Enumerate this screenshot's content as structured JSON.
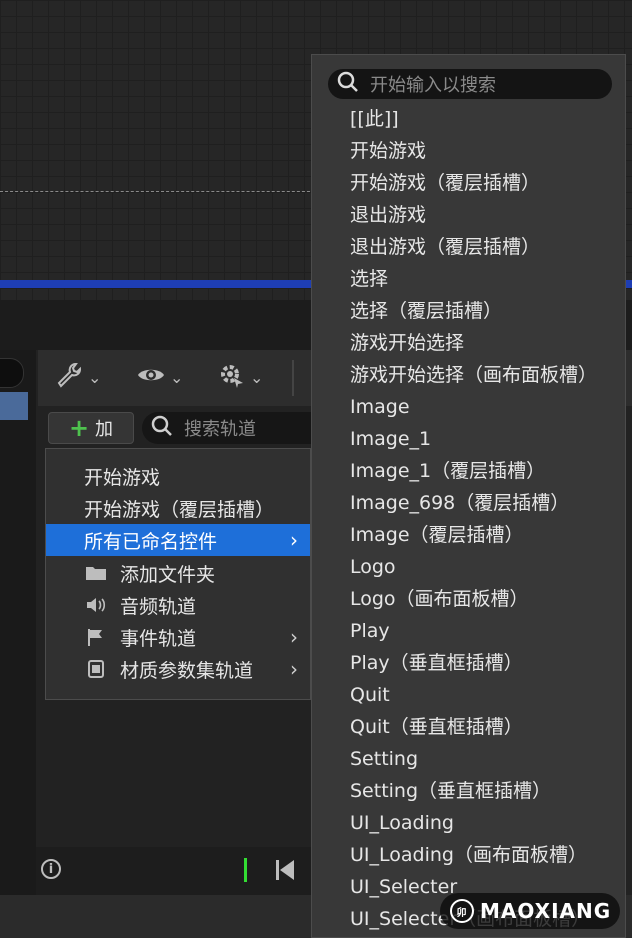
{
  "toolbar": {
    "add_label": "加",
    "search_placeholder": "搜索轨道",
    "icons": [
      "wrench-icon",
      "eye-icon",
      "gear-icon"
    ]
  },
  "context_menu": {
    "items": [
      {
        "label": "开始游戏",
        "icon": "",
        "submenu": false,
        "selected": false
      },
      {
        "label": "开始游戏（覆层插槽）",
        "icon": "",
        "submenu": false,
        "selected": false
      },
      {
        "label": "所有已命名控件",
        "icon": "",
        "submenu": true,
        "selected": true
      },
      {
        "label": "添加文件夹",
        "icon": "folder-icon",
        "submenu": false,
        "selected": false
      },
      {
        "label": "音频轨道",
        "icon": "speaker-icon",
        "submenu": false,
        "selected": false
      },
      {
        "label": "事件轨道",
        "icon": "flag-icon",
        "submenu": true,
        "selected": false
      },
      {
        "label": "材质参数集轨道",
        "icon": "material-icon",
        "submenu": true,
        "selected": false
      }
    ]
  },
  "dropdown": {
    "search_placeholder": "开始输入以搜索",
    "items": [
      "[[此]]",
      "开始游戏",
      "开始游戏（覆层插槽）",
      "退出游戏",
      "退出游戏（覆层插槽）",
      "选择",
      "选择（覆层插槽）",
      "游戏开始选择",
      "游戏开始选择（画布面板槽）",
      "Image",
      "Image_1",
      "Image_1（覆层插槽）",
      "Image_698（覆层插槽）",
      "Image（覆层插槽）",
      "Logo",
      "Logo（画布面板槽）",
      "Play",
      "Play（垂直框插槽）",
      "Quit",
      "Quit（垂直框插槽）",
      "Setting",
      "Setting（垂直框插槽）",
      "UI_Loading",
      "UI_Loading（画布面板槽）",
      "UI_Selecter",
      "UI_Selecter（画布面板槽）"
    ]
  },
  "watermark": {
    "text": "MAOXIANG",
    "logo_text": "卯"
  },
  "colors": {
    "selected": "#1e6fd9",
    "accent_green": "#4ec24e",
    "timeline_blue": "#1e3eb4"
  }
}
